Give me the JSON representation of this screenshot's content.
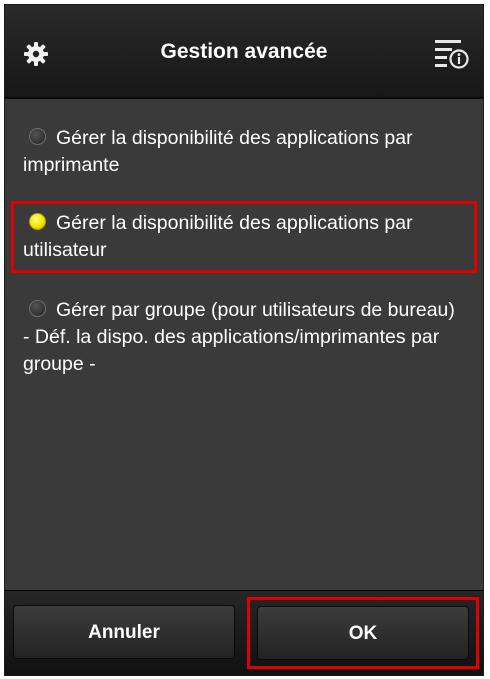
{
  "header": {
    "title": "Gestion avancée",
    "left_icon": "gear-icon",
    "right_icon": "info-menu-icon"
  },
  "options": [
    {
      "label": "Gérer la disponibilité des applications par imprimante",
      "selected": false
    },
    {
      "label": "Gérer la disponibilité des applications par utilisateur",
      "selected": true
    },
    {
      "label": "Gérer par groupe (pour utilisateurs de bureau)",
      "sublabel": "- Déf. la dispo. des applications/imprimantes par groupe -",
      "selected": false
    }
  ],
  "footer": {
    "cancel_label": "Annuler",
    "ok_label": "OK"
  },
  "colors": {
    "highlight": "#e00000",
    "radio_checked": "#f5e400",
    "background": "#3a3a3a"
  }
}
